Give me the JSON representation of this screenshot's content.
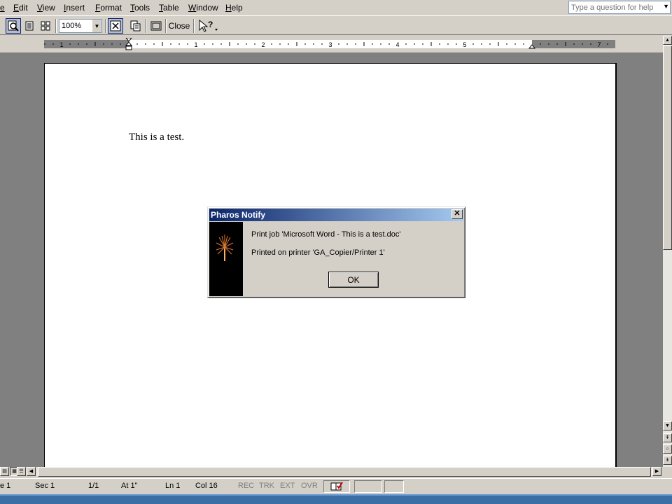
{
  "menubar": {
    "items": [
      {
        "label": "e"
      },
      {
        "label": "Edit"
      },
      {
        "label": "View"
      },
      {
        "label": "Insert"
      },
      {
        "label": "Format"
      },
      {
        "label": "Tools"
      },
      {
        "label": "Table"
      },
      {
        "label": "Window"
      },
      {
        "label": "Help"
      }
    ],
    "help_placeholder": "Type a question for help"
  },
  "toolbar": {
    "zoom_value": "100%",
    "close_label": "Close",
    "icons": [
      "magnifier-icon",
      "one-page-icon",
      "multiple-pages-icon",
      "view-ruler-icon",
      "shrink-to-fit-icon",
      "full-screen-icon",
      "context-help-icon"
    ]
  },
  "ruler": {
    "numbers": [
      "1",
      "1",
      "2",
      "3",
      "4",
      "5",
      "7"
    ]
  },
  "document": {
    "text": "This is a test."
  },
  "dialog": {
    "title": "Pharos Notify",
    "line1": "Print job 'Microsoft Word - This is a test.doc'",
    "line2": "Printed on printer 'GA_Copier/Printer 1'",
    "ok_label": "OK"
  },
  "statusbar": {
    "page": "e  1",
    "sec": "Sec  1",
    "pages": "1/1",
    "at": "At  1\"",
    "ln": "Ln  1",
    "col": "Col  16",
    "rec": "REC",
    "trk": "TRK",
    "ext": "EXT",
    "ovr": "OVR"
  },
  "colors": {
    "title_bar_start": "#0a246a",
    "title_bar_end": "#a6caf0",
    "desktop_gray": "#808080"
  }
}
